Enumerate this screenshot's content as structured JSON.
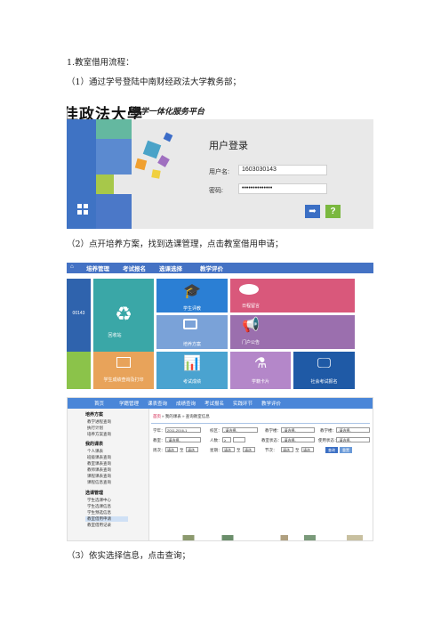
{
  "doc": {
    "heading": "1.教室借用流程：",
    "step1": "（1）通过学号登陆中南财经政法大学教务部；",
    "step2": "（2）点开培养方案，找到选课管理，点击教室借用申请；",
    "step3": "（3）依实选择信息，点击查询；"
  },
  "shot1": {
    "logo": "佳政法大學",
    "platform": "教学一体化服务平台",
    "login_title": "用户登录",
    "user_label": "用户名:",
    "user_value": "1603030143",
    "pwd_label": "密码:",
    "pwd_value": "••••••••••••••"
  },
  "shot2": {
    "nav": [
      "培养管理",
      "考试报名",
      "选课选择",
      "教学评价"
    ],
    "left_number": "00143",
    "tiles": {
      "recycle": "回收站",
      "teach_eval": "学生评教",
      "blog": "日程留言",
      "train_plan": "培养方案",
      "notice": "门户公告",
      "grades": "学生成绩查询及打印",
      "exam": "考试成绩",
      "lab": "学籍卡片",
      "eval2": "社会考试报名"
    }
  },
  "shot3": {
    "nav": [
      "首页",
      "学籍管理",
      "课表查询",
      "成绩查询",
      "考试报名",
      "实践环节",
      "教学评价"
    ],
    "breadcrumb_home": "首页",
    "breadcrumb_path": "» 我的课表 » 查询教室信息",
    "sidebar": {
      "plan_title": "培养方案",
      "plan_items": [
        "教学进程查询",
        "执行计划",
        "培养方案查询"
      ],
      "course_title": "我的课表",
      "course_items": [
        "个人课表",
        "班级课表查询",
        "教室课表查询",
        "教师课表查询",
        "课程课表查询",
        "课程信息查询"
      ],
      "select_title": "选课管理",
      "select_items": [
        "学生选课中心",
        "学生选课信息",
        "学生预选信息",
        "教室借用申请",
        "教室借用记录"
      ]
    },
    "form": {
      "row1": [
        {
          "label": "学年：",
          "value": "2011-2016-1"
        },
        {
          "label": "校区：",
          "value": "-请选择-"
        },
        {
          "label": "教学楼：",
          "value": "-请选择-"
        },
        {
          "label": "教学楼：",
          "value": "-请选择-"
        }
      ],
      "row2": [
        {
          "label": "教室：",
          "value": "-请选择-"
        },
        {
          "label": "人数：",
          "value": "≥"
        },
        {
          "label": "教室状态：",
          "value": "-请选择-"
        },
        {
          "label": "使用状态：",
          "value": "-请选择-"
        }
      ],
      "row3_label1": "周次：",
      "row3_label2": "星期：",
      "row3_label3": "节次：",
      "select_placeholder": "请选",
      "to": "至",
      "query_btn": "查询",
      "reset_btn": "重置"
    }
  },
  "colors": {
    "nav_blue": "#4472c4",
    "teal": "#3aa7a7",
    "pink": "#d9587b",
    "purple": "#9b6fae",
    "green": "#8bc34a",
    "orange": "#e8a35a"
  }
}
